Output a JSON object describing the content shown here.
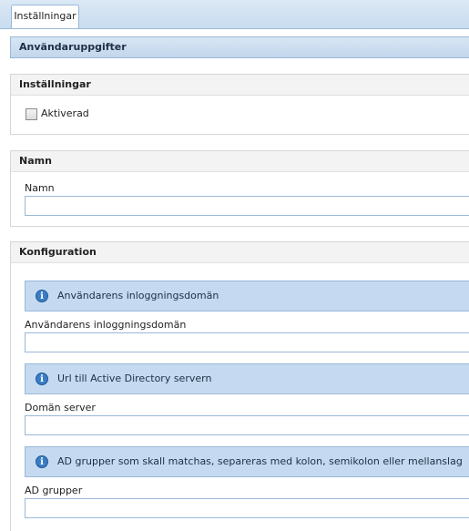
{
  "tabs": [
    {
      "label": "Inställningar"
    }
  ],
  "title": "Användaruppgifter",
  "settings_section": {
    "title": "Inställningar",
    "checkbox_label": "Aktiverad",
    "checked": false
  },
  "name_section": {
    "title": "Namn",
    "field_label": "Namn",
    "value": ""
  },
  "config_section": {
    "title": "Konfiguration",
    "items": [
      {
        "info": "Användarens inloggningsdomän",
        "label": "Användarens inloggningsdomän",
        "value": ""
      },
      {
        "info": "Url till Active Directory servern",
        "label": "Domän server",
        "value": ""
      },
      {
        "info": "AD grupper som skall matchas, separeras med kolon, semikolon eller mellanslag",
        "label": "AD grupper",
        "value": ""
      }
    ]
  },
  "icons": {
    "info": "info-icon"
  },
  "colors": {
    "header_blue": "#c9dcef",
    "info_blue": "#c5daf0",
    "border_blue": "#9ab8d8"
  }
}
